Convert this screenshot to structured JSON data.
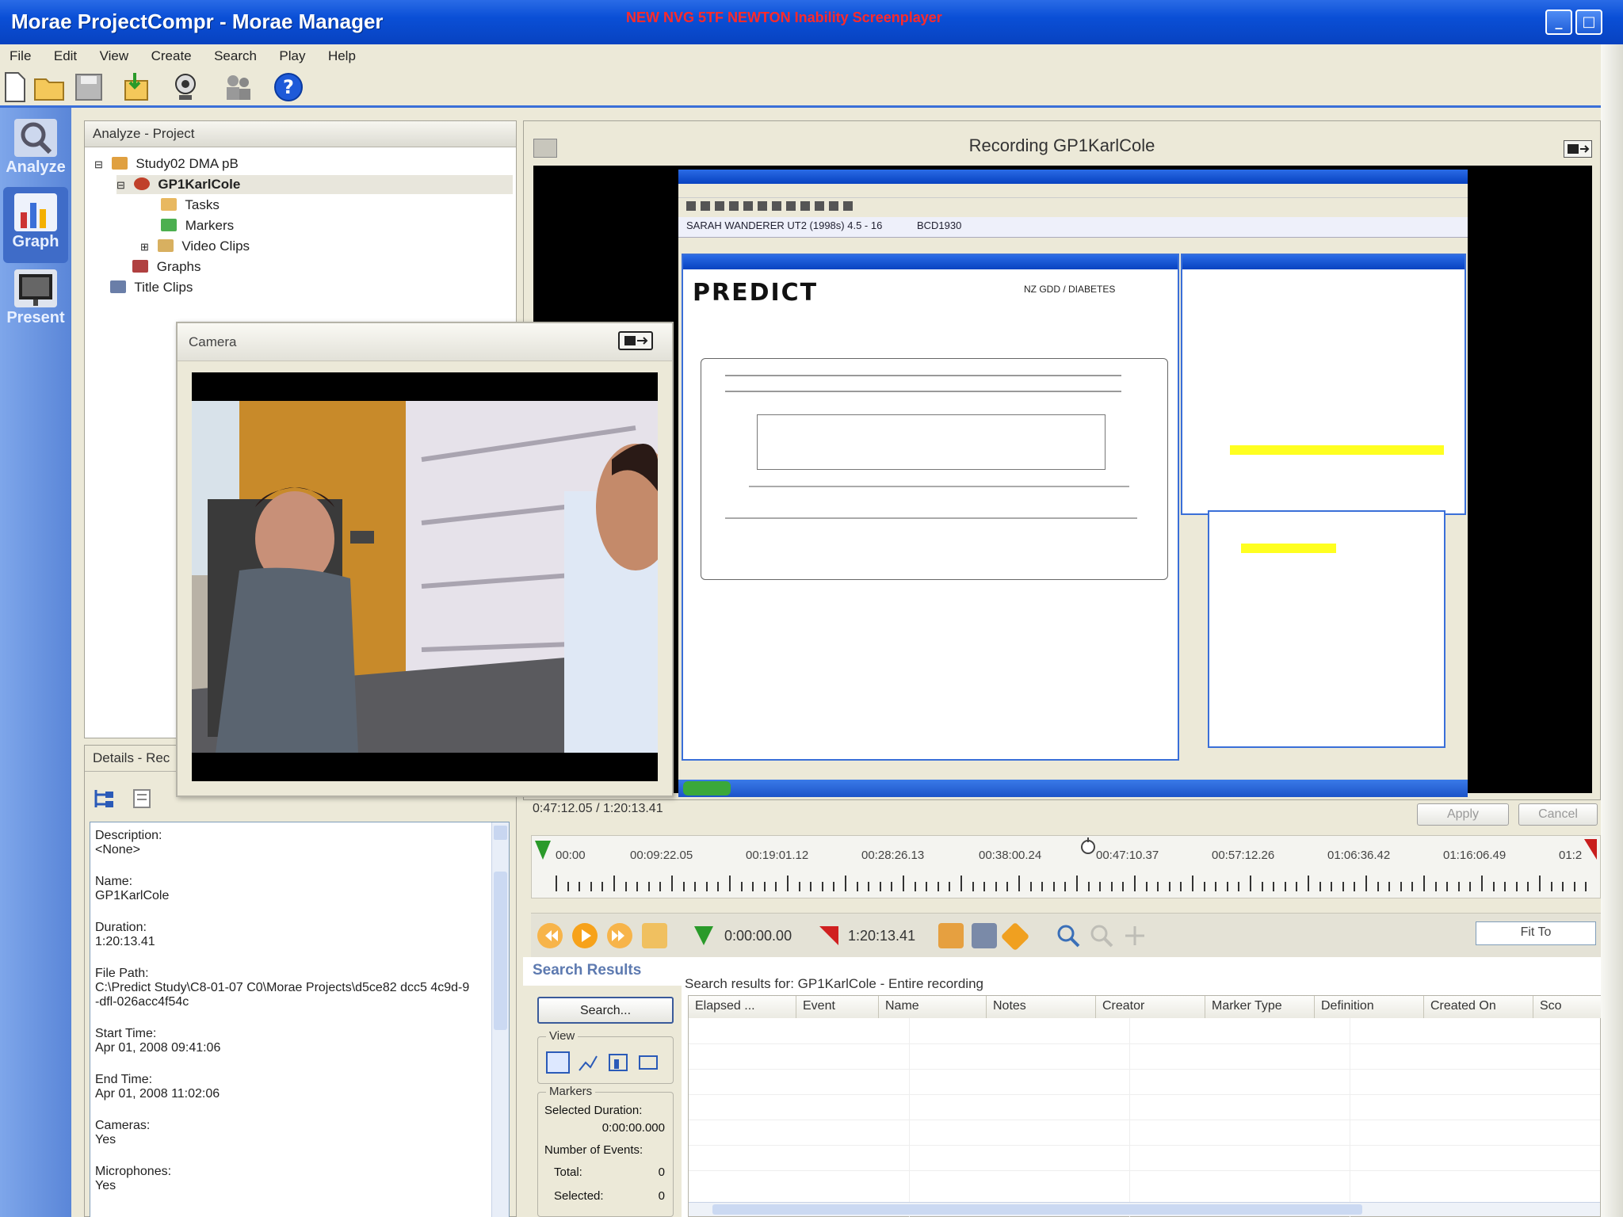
{
  "window": {
    "title": "Morae ProjectCompr - Morae Manager",
    "warning": "NEW NVG 5TF NEWTON Inability Screenplayer"
  },
  "menu": [
    "File",
    "Edit",
    "View",
    "Create",
    "Search",
    "Play",
    "Help"
  ],
  "nav": {
    "analyze": "Analyze",
    "graph": "Graph",
    "present": "Present"
  },
  "project": {
    "header": "Analyze - Project",
    "items": [
      "Study02 DMA pB",
      "GP1KarlCole",
      "Tasks",
      "Markers",
      "Video Clips",
      "Graphs",
      "Title Clips"
    ]
  },
  "details": {
    "header": "Details - Rec",
    "fields": [
      {
        "label": "Description:",
        "value": "<None>"
      },
      {
        "label": "Name:",
        "value": "GP1KarlCole"
      },
      {
        "label": "Duration:",
        "value": "1:20:13.41"
      },
      {
        "label": "File Path:",
        "value": "C:\\Predict Study\\C8-01-07 C0\\Morae Projects\\d5ce82 dcc5 4c9d-9-dfl-026acc4f54c"
      },
      {
        "label": "Start Time:",
        "value": "Apr 01, 2008 09:41:06"
      },
      {
        "label": "End Time:",
        "value": "Apr 01, 2008 11:02:06"
      },
      {
        "label": "Cameras:",
        "value": "Yes"
      },
      {
        "label": "Microphones:",
        "value": "Yes"
      }
    ]
  },
  "recording": {
    "title": "Recording   GP1KarlCole",
    "timecode": "0:47:12.05 / 1:20:13.41",
    "apply": "Apply",
    "cancel": "Cancel",
    "timeline_labels": [
      "00:00",
      "00:09:22.05",
      "00:19:01.12",
      "00:28:26.13",
      "00:38:00.24",
      "00:47:10.37",
      "00:57:12.26",
      "01:06:36.42",
      "01:16:06.49",
      "01:2"
    ]
  },
  "capture": {
    "patient": "SARAH WANDERER UT2 (1998s) 4.5 - 16",
    "id": "BCD1930",
    "logo": "PREDICT",
    "docheader": "NZ GDD / DIABETES"
  },
  "camera": {
    "title": "Camera"
  },
  "controls": {
    "in_time": "0:00:00.00",
    "out_time": "1:20:13.41",
    "zoom": "Fit To"
  },
  "search": {
    "title": "Search Results",
    "caption": "Search results for: GP1KarlCole - Entire recording",
    "button": "Search...",
    "view_label": "View",
    "markers_label": "Markers",
    "selected_duration_label": "Selected Duration:",
    "selected_duration": "0:00:00.000",
    "num_events_label": "Number of Events:",
    "total_label": "Total:",
    "total": "0",
    "selected_label": "Selected:",
    "selected": "0",
    "columns": [
      "Elapsed ...",
      "Event",
      "Name",
      "Notes",
      "Creator",
      "Marker Type",
      "Definition",
      "Created On",
      "Sco"
    ]
  }
}
